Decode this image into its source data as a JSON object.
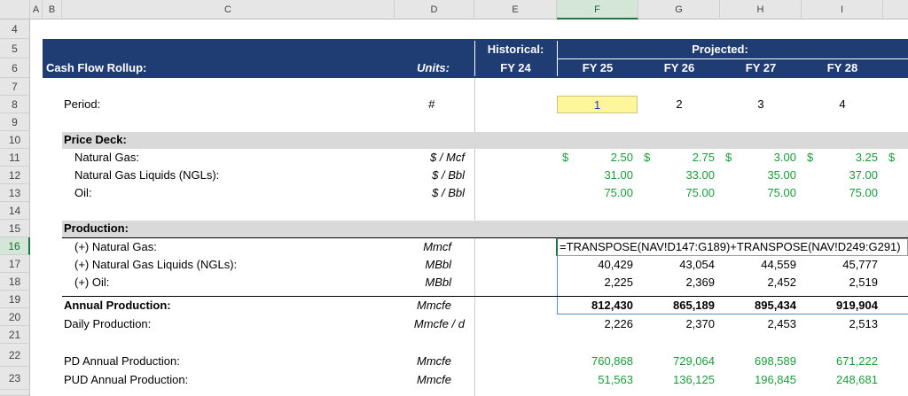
{
  "columns": [
    "A",
    "B",
    "C",
    "D",
    "E",
    "F",
    "G",
    "H",
    "I"
  ],
  "rows": [
    "4",
    "5",
    "6",
    "7",
    "8",
    "9",
    "10",
    "11",
    "12",
    "13",
    "14",
    "15",
    "16",
    "17",
    "18",
    "19",
    "20",
    "21",
    "22",
    "23"
  ],
  "header": {
    "historical": "Historical:",
    "projected": "Projected:",
    "title": "Cash Flow Rollup:",
    "units": "Units:",
    "years": [
      "FY 24",
      "FY 25",
      "FY 26",
      "FY 27",
      "FY 28"
    ]
  },
  "period": {
    "label": "Period:",
    "unit": "#",
    "values": [
      "1",
      "2",
      "3",
      "4"
    ]
  },
  "price_deck": {
    "title": "Price Deck:",
    "currency": "$",
    "rows": [
      {
        "label": "Natural Gas:",
        "unit": "$ / Mcf",
        "values": [
          "2.50",
          "2.75",
          "3.00",
          "3.25"
        ]
      },
      {
        "label": "Natural Gas Liquids (NGLs):",
        "unit": "$ / Bbl",
        "values": [
          "31.00",
          "33.00",
          "35.00",
          "37.00"
        ]
      },
      {
        "label": "Oil:",
        "unit": "$ / Bbl",
        "values": [
          "75.00",
          "75.00",
          "75.00",
          "75.00"
        ]
      }
    ]
  },
  "production": {
    "title": "Production:",
    "formula": "=TRANSPOSE(NAV!D147:G189)+TRANSPOSE(NAV!D249:G291)",
    "gas": {
      "label": "(+) Natural Gas:",
      "unit": "Mmcf"
    },
    "ngl": {
      "label": "(+) Natural Gas Liquids (NGLs):",
      "unit": "MBbl",
      "values": [
        "40,429",
        "43,054",
        "44,559",
        "45,777"
      ]
    },
    "oil": {
      "label": "(+) Oil:",
      "unit": "MBbl",
      "values": [
        "2,225",
        "2,369",
        "2,452",
        "2,519"
      ]
    },
    "annual": {
      "label": "Annual Production:",
      "unit": "Mmcfe",
      "values": [
        "812,430",
        "865,189",
        "895,434",
        "919,904"
      ]
    },
    "daily": {
      "label": "Daily Production:",
      "unit": "Mmcfe / d",
      "values": [
        "2,226",
        "2,370",
        "2,453",
        "2,513"
      ]
    }
  },
  "pd": {
    "label": "PD Annual Production:",
    "unit": "Mmcfe",
    "values": [
      "760,868",
      "729,064",
      "698,589",
      "671,222"
    ]
  },
  "pud": {
    "label": "PUD Annual Production:",
    "unit": "Mmcfe",
    "values": [
      "51,563",
      "136,125",
      "196,845",
      "248,681"
    ]
  }
}
